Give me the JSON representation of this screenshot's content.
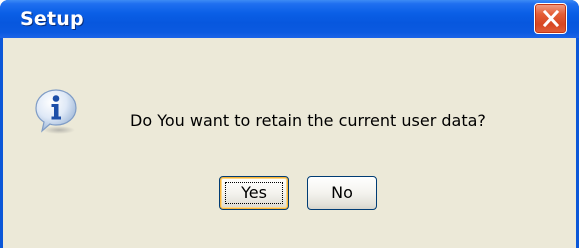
{
  "window": {
    "title": "Setup"
  },
  "dialog": {
    "icon": "info-icon",
    "message": "Do You want to retain the current user data?"
  },
  "buttons": {
    "yes_label": "Yes",
    "no_label": "No"
  },
  "colors": {
    "titlebar": "#0a5fe6",
    "client_bg": "#ece9d8",
    "close_button": "#d74722",
    "button_border": "#003c74",
    "focus_highlight": "#f8b33a"
  }
}
